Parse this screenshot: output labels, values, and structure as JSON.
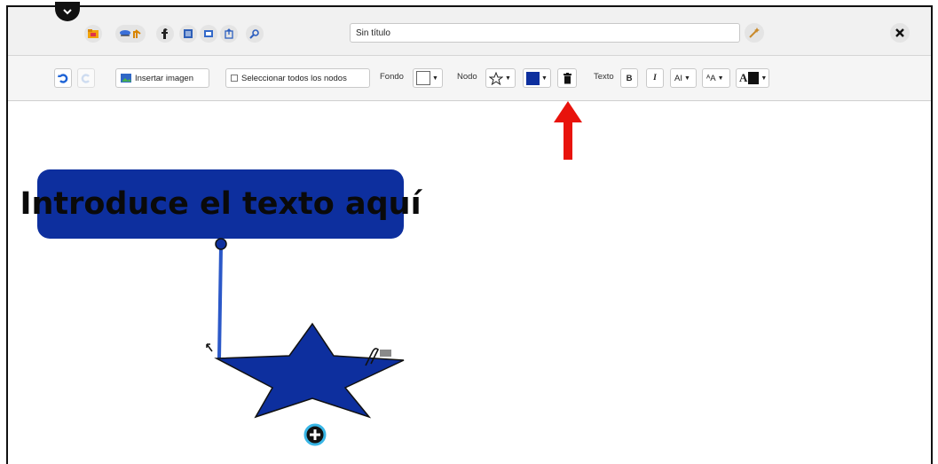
{
  "header": {
    "document_title": "Sin título",
    "icons": [
      "menu-chevron-icon",
      "open-folder-icon",
      "save-icon",
      "share-icon",
      "text-icon",
      "presentation-icon",
      "export-icon",
      "search-icon",
      "magic-wand-icon",
      "close-icon"
    ]
  },
  "toolbar": {
    "insert_image": "Insertar imagen",
    "select_all": "Seleccionar todos los nodos",
    "background_label": "Fondo",
    "node_label": "Nodo",
    "text_label": "Texto",
    "bold": "B",
    "italic": "I",
    "font_size": "AI",
    "letter_case": "ᴬA",
    "font_color_glyph": "A"
  },
  "canvas": {
    "root_node_text": "Introduce el texto aquí",
    "node_color": "#0d2f9e",
    "selected_node_color": "#0d2f9e"
  },
  "annotation": {
    "arrow_color": "#e8130c",
    "points_to": "delete-node-button"
  }
}
